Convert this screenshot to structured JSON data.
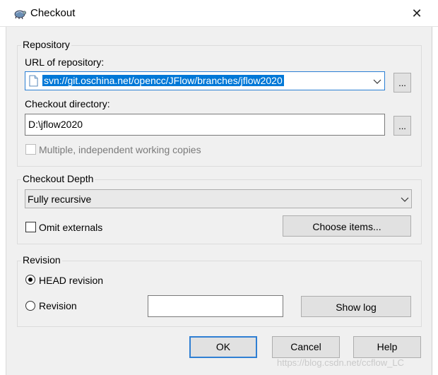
{
  "window": {
    "title": "Checkout",
    "close_glyph": "✕",
    "app_icon": "tortoise-svn-icon"
  },
  "repository": {
    "group_label": "Repository",
    "url_label": "URL of repository:",
    "url_value": "svn://git.oschina.net/opencc/JFlow/branches/jflow2020",
    "url_browse": "...",
    "dir_label": "Checkout directory:",
    "dir_value": "D:\\jflow2020",
    "dir_browse": "...",
    "multiple_label": "Multiple, independent working copies",
    "multiple_checked": false
  },
  "depth": {
    "group_label": "Checkout Depth",
    "selected": "Fully recursive",
    "omit_label": "Omit externals",
    "omit_checked": false,
    "choose_items": "Choose items..."
  },
  "revision": {
    "group_label": "Revision",
    "head_label": "HEAD revision",
    "revision_label": "Revision",
    "selected": "HEAD revision",
    "revision_value": "",
    "show_log": "Show log"
  },
  "footer": {
    "ok": "OK",
    "cancel": "Cancel",
    "help": "Help",
    "watermark": "https://blog.csdn.net/ccflow_LC"
  },
  "colors": {
    "accent": "#0078d7",
    "default_border": "#2f7fd3"
  }
}
